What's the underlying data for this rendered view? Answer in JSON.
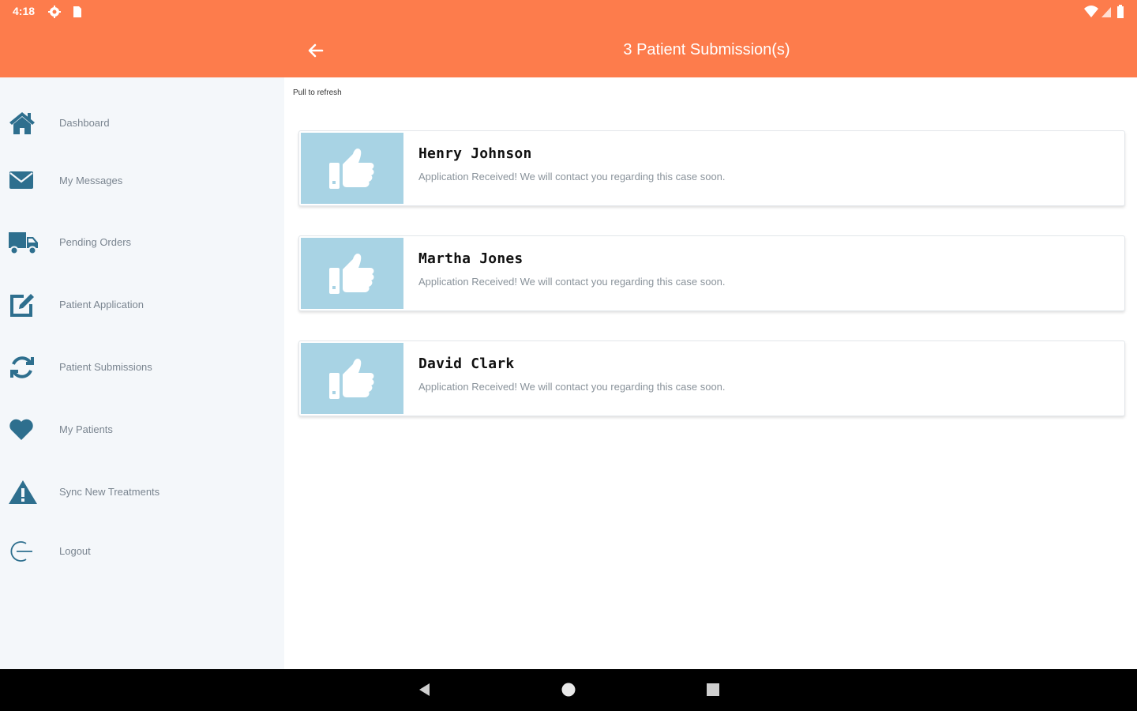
{
  "status_bar": {
    "time": "4:18",
    "icons": [
      "gear-icon",
      "sim-card-icon",
      "wifi-icon",
      "signal-icon",
      "battery-icon"
    ]
  },
  "app_bar": {
    "back_icon": "arrow-left-icon",
    "title": "3 Patient Submission(s)"
  },
  "sidebar": {
    "items": [
      {
        "label": "Dashboard",
        "icon": "home-icon"
      },
      {
        "label": "My Messages",
        "icon": "envelope-icon"
      },
      {
        "label": "Pending Orders",
        "icon": "truck-icon"
      },
      {
        "label": "Patient Application",
        "icon": "edit-icon"
      },
      {
        "label": "Patient Submissions",
        "icon": "refresh-icon"
      },
      {
        "label": "My Patients",
        "icon": "heart-icon"
      },
      {
        "label": "Sync New Treatments",
        "icon": "warning-icon"
      },
      {
        "label": "Logout",
        "icon": "logout-icon"
      }
    ]
  },
  "main": {
    "pull_hint": "Pull to refresh",
    "submissions": [
      {
        "name": "Henry Johnson",
        "message": "Application Received! We will contact you regarding this case soon.",
        "icon": "thumbs-up-icon"
      },
      {
        "name": "Martha Jones",
        "message": "Application Received! We will contact you regarding this case soon.",
        "icon": "thumbs-up-icon"
      },
      {
        "name": "David Clark",
        "message": "Application Received! We will contact you regarding this case soon.",
        "icon": "thumbs-up-icon"
      }
    ]
  },
  "system_nav": {
    "icons": [
      "back-triangle-icon",
      "home-circle-icon",
      "recents-square-icon"
    ]
  },
  "colors": {
    "accent": "#fd7c4c",
    "sidebar_bg": "#f4f7fa",
    "icon": "#2e6f8e",
    "thumb_bg": "#a8d3e4"
  }
}
